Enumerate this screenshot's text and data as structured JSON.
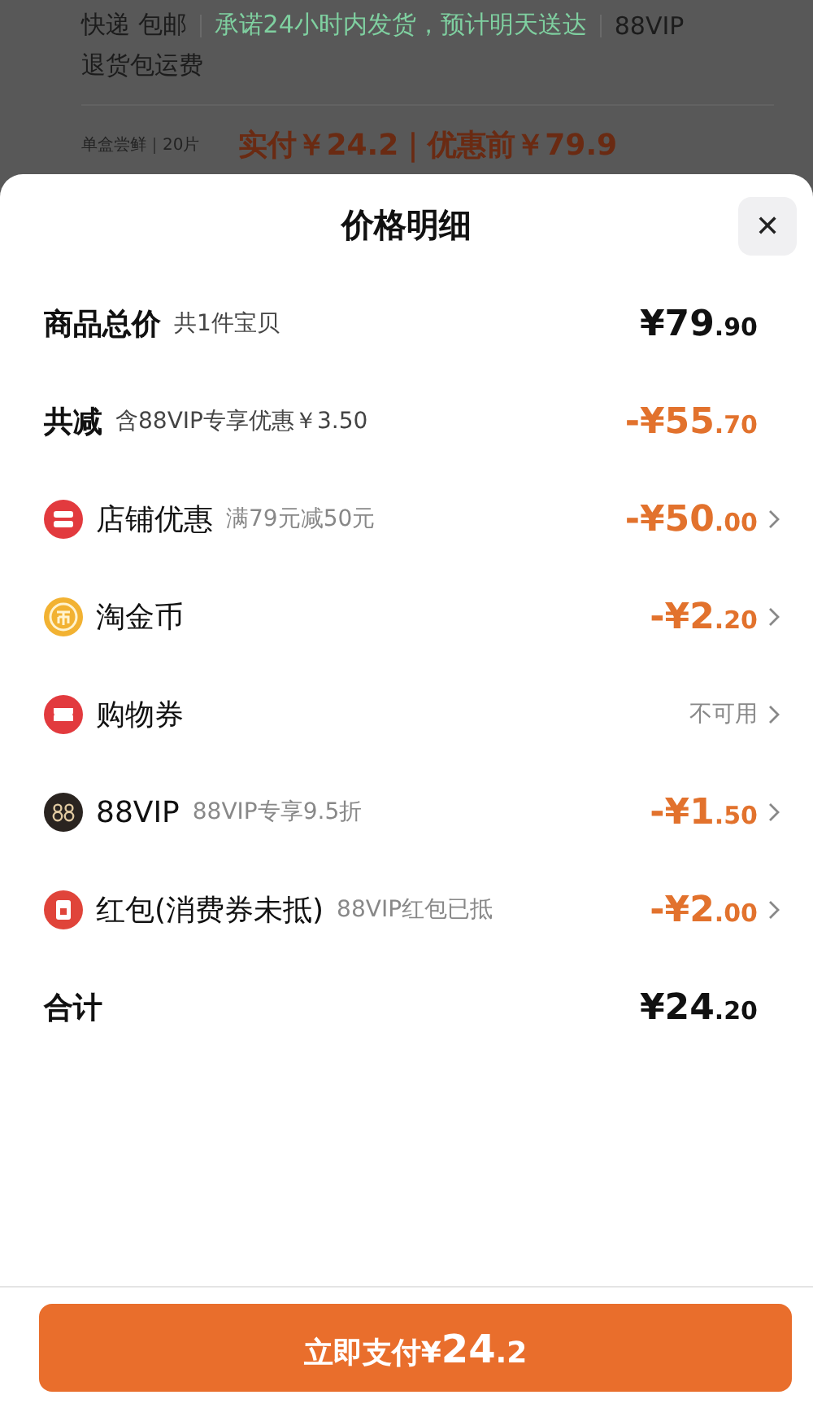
{
  "background": {
    "shipping_tags": [
      {
        "text": "快递 包邮",
        "kind": "plain"
      },
      {
        "text": "承诺24小时内发货，预计明天送达",
        "kind": "promise"
      },
      {
        "text": "88VIP",
        "kind": "plain"
      }
    ],
    "shipping_note": "退货包运费",
    "sku_label": "单盒尝鲜｜20片",
    "price_line": "实付￥24.2｜优惠前￥79.9"
  },
  "sheet": {
    "title": "价格明细",
    "close": "✕",
    "rows": [
      {
        "kind": "sum",
        "label": "商品总价",
        "note": "共1件宝贝",
        "amount": "¥79",
        "decimal": ".90"
      },
      {
        "kind": "reduction",
        "label": "共减",
        "note": "含88VIP专享优惠￥3.50",
        "amount": "-¥55",
        "decimal": ".70"
      },
      {
        "kind": "shop",
        "label": "店铺优惠",
        "note": "满79元减50元",
        "amount": "-¥50",
        "decimal": ".00"
      },
      {
        "kind": "coin",
        "label": "淘金币",
        "amount": "-¥2",
        "decimal": ".20"
      },
      {
        "kind": "ticket",
        "label": "购物券",
        "status": "不可用"
      },
      {
        "kind": "vip",
        "label": "88VIP",
        "note": "88VIP专享9.5折",
        "amount": "-¥1",
        "decimal": ".50"
      },
      {
        "kind": "packet",
        "label": "红包(消费券未抵)",
        "note": "88VIP红包已抵",
        "amount": "-¥2",
        "decimal": ".00"
      },
      {
        "kind": "sum",
        "label": "合计",
        "amount": "¥24",
        "decimal": ".20"
      }
    ],
    "pay_button": {
      "label": "立即支付",
      "currency": "¥",
      "amount": "24",
      "decimal": ".2"
    }
  }
}
